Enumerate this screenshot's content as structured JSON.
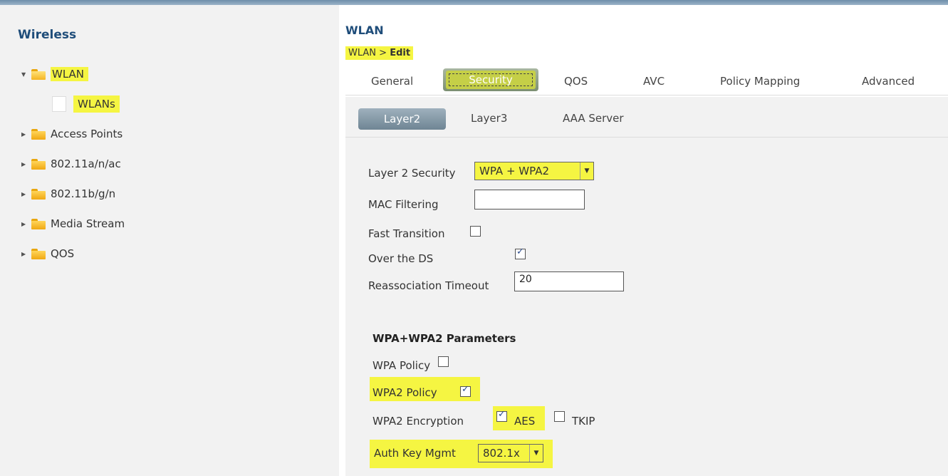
{
  "sidebar": {
    "title": "Wireless",
    "items": [
      {
        "label": "WLAN",
        "icon": "folder-open-icon"
      },
      {
        "label": "WLANs",
        "icon": "page-icon"
      },
      {
        "label": "Access Points",
        "icon": "folder-icon"
      },
      {
        "label": "802.11a/n/ac",
        "icon": "folder-icon"
      },
      {
        "label": "802.11b/g/n",
        "icon": "folder-icon"
      },
      {
        "label": "Media Stream",
        "icon": "folder-icon"
      },
      {
        "label": "QOS",
        "icon": "folder-icon"
      }
    ]
  },
  "header": {
    "title": "WLAN",
    "breadcrumb_parent": "WLAN",
    "breadcrumb_sep": " > ",
    "breadcrumb_current": "Edit"
  },
  "tabs": [
    "General",
    "Security",
    "QOS",
    "AVC",
    "Policy Mapping",
    "Advanced"
  ],
  "active_tab": "Security",
  "subtabs": [
    "Layer2",
    "Layer3",
    "AAA Server"
  ],
  "active_subtab": "Layer2",
  "layer2": {
    "security_label": "Layer 2 Security",
    "security_value": "WPA + WPA2",
    "mac_filtering_label": "MAC Filtering",
    "fast_transition_label": "Fast Transition",
    "over_ds_label": "Over the DS",
    "reassoc_label": "Reassociation Timeout",
    "reassoc_value": "20"
  },
  "wpa": {
    "heading": "WPA+WPA2 Parameters",
    "wpa_policy_label": "WPA Policy",
    "wpa2_policy_label": "WPA2 Policy",
    "wpa2_encryption_label": "WPA2 Encryption",
    "aes_label": "AES",
    "tkip_label": "TKIP",
    "auth_key_label": "Auth Key Mgmt",
    "auth_key_value": "802.1x"
  },
  "colors": {
    "highlight": "#f5f542",
    "title": "#1f4d7a"
  }
}
